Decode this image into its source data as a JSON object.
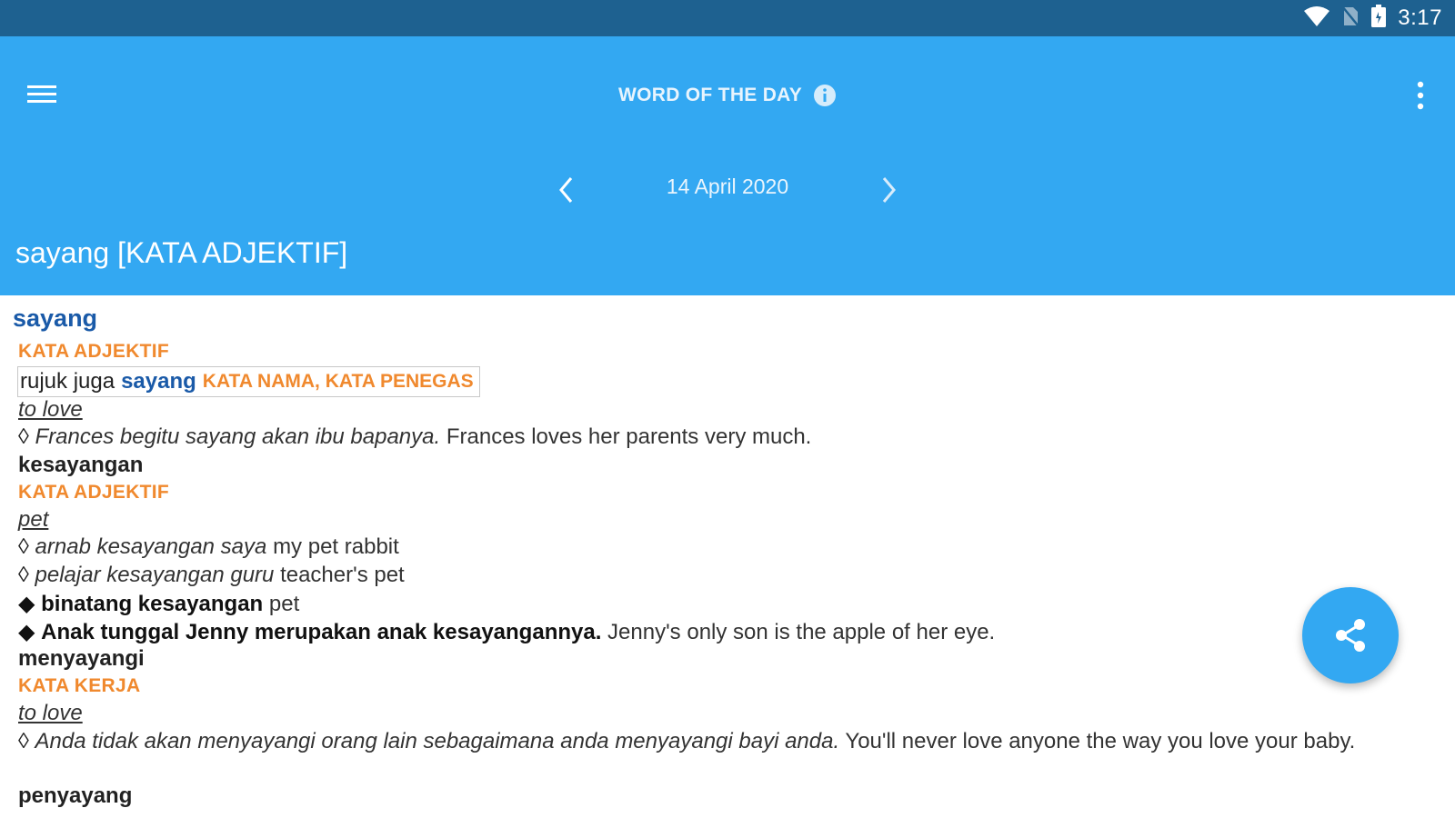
{
  "status_bar": {
    "time": "3:17",
    "icons": [
      "wifi-icon",
      "no-sim-icon",
      "battery-icon"
    ]
  },
  "app_bar": {
    "title": "WORD OF THE DAY",
    "menu_icon": "hamburger-menu-icon",
    "info_icon": "info-icon",
    "overflow_icon": "more-vertical-icon",
    "background": "#33a8f2",
    "status_background": "#1e6190"
  },
  "date_nav": {
    "date": "14 April 2020",
    "prev_icon": "chevron-left-icon",
    "next_icon": "chevron-right-icon"
  },
  "word_heading": "sayang [KATA ADJEKTIF]",
  "entry": {
    "headword": "sayang",
    "pos1": "KATA ADJEKTIF",
    "xref_prefix": "rujuk juga",
    "xref_word": "sayang",
    "xref_pos": "KATA NAMA, KATA PENEGAS",
    "translation1": "to love",
    "example1_ms": "Frances begitu sayang akan ibu bapanya.",
    "example1_en": "Frances loves her parents very much.",
    "derived1": "kesayangan",
    "pos2": "KATA ADJEKTIF",
    "translation2": "pet",
    "example2_ms": "arnab kesayangan saya",
    "example2_en": "my pet rabbit",
    "example3_ms": "pelajar kesayangan guru",
    "example3_en": "teacher's pet",
    "idiom1_ms": "binatang kesayangan",
    "idiom1_en": "pet",
    "idiom2_ms": "Anak tunggal Jenny merupakan anak kesayangannya.",
    "idiom2_en": "Jenny's only son is the apple of her eye.",
    "derived2": "menyayangi",
    "pos3": "KATA KERJA",
    "translation3": "to love",
    "example4_ms": "Anda tidak akan menyayangi orang lain sebagaimana anda menyayangi bayi anda.",
    "example4_en": "You'll never love anyone the way you love your baby.",
    "derived3": "penyayang",
    "example_marker": "◊",
    "idiom_marker": "◆",
    "colors": {
      "headword": "#1a5aa8",
      "pos": "#f0892e"
    }
  },
  "fab": {
    "icon": "share-icon"
  }
}
